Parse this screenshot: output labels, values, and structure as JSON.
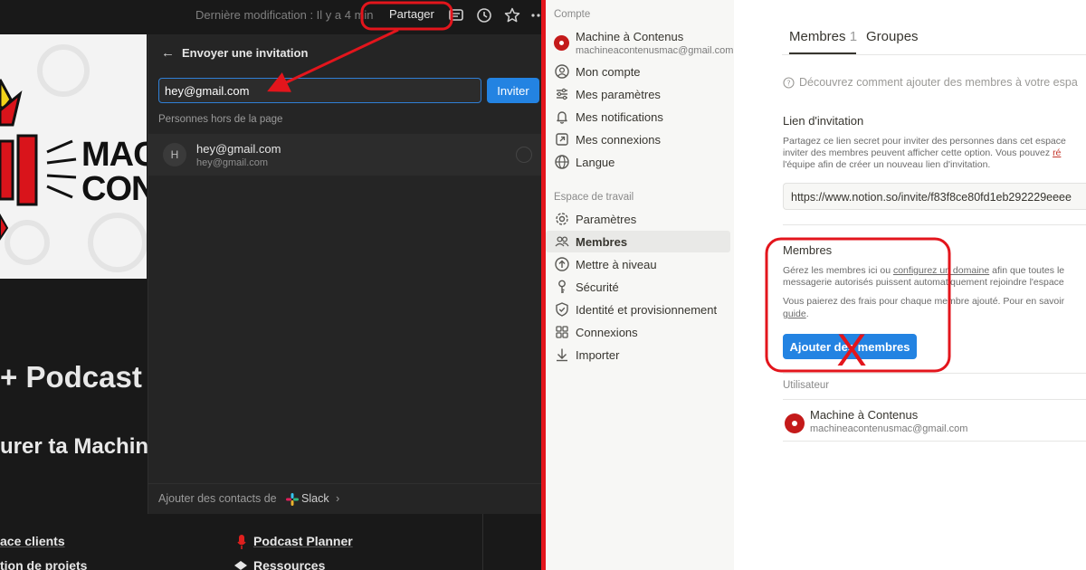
{
  "left_pane": {
    "topbar": {
      "last_modified": "Dernière modification : Il y a 4 min",
      "share_label": "Partager"
    },
    "cover": {
      "line1": "MAC",
      "line2": "CON"
    },
    "page_heading": "+ Podcast",
    "page_subheading": "urer ta Machin",
    "bottom_links": [
      "ace clients",
      "tion de projets",
      "Podcast Planner",
      "Ressources"
    ],
    "invite_popup": {
      "title": "Envoyer une invitation",
      "email_value": "hey@gmail.com",
      "invite_button": "Inviter",
      "outside_label": "Personnes hors de la page",
      "person": {
        "initial": "H",
        "name": "hey@gmail.com",
        "email": "hey@gmail.com"
      },
      "footer_text": "Ajouter des contacts de",
      "footer_app": "Slack"
    }
  },
  "settings": {
    "sidebar": {
      "account_section": "Compte",
      "account_name": "Machine à Contenus",
      "account_email": "machineacontenusmac@gmail.com",
      "account_items": [
        {
          "label": "Mon compte",
          "icon": "user-circle-icon"
        },
        {
          "label": "Mes paramètres",
          "icon": "sliders-icon"
        },
        {
          "label": "Mes notifications",
          "icon": "bell-icon"
        },
        {
          "label": "Mes connexions",
          "icon": "external-link-icon"
        },
        {
          "label": "Langue",
          "icon": "globe-icon"
        }
      ],
      "workspace_section": "Espace de travail",
      "workspace_items": [
        {
          "label": "Paramètres",
          "icon": "gear-icon"
        },
        {
          "label": "Membres",
          "icon": "people-icon",
          "active": true
        },
        {
          "label": "Mettre à niveau",
          "icon": "arrow-up-circle-icon"
        },
        {
          "label": "Sécurité",
          "icon": "key-icon"
        },
        {
          "label": "Identité et provisionnement",
          "icon": "shield-check-icon"
        },
        {
          "label": "Connexions",
          "icon": "grid-icon"
        },
        {
          "label": "Importer",
          "icon": "download-icon"
        }
      ]
    },
    "main": {
      "tabs": [
        {
          "label": "Membres",
          "count": "1"
        },
        {
          "label": "Groupes"
        }
      ],
      "learn_text": "Découvrez comment ajouter des membres à votre espa",
      "invite_link": {
        "title": "Lien d'invitation",
        "desc_line1": "Partagez ce lien secret pour inviter des personnes dans cet espace",
        "desc_line2_a": "inviter des membres peuvent afficher cette option. Vous pouvez ",
        "desc_line2_link": "ré",
        "desc_line3": "l'équipe afin de créer un nouveau lien d'invitation.",
        "url": "https://www.notion.so/invite/f83f8ce80fd1eb292229eeee"
      },
      "members": {
        "title": "Membres",
        "desc1_a": "Gérez les membres ici ou ",
        "desc1_link": "configurez un domaine",
        "desc1_b": " afin que toutes le",
        "desc2": "messagerie autorisés puissent automatiquement rejoindre l'espace",
        "desc3": "Vous paierez des frais pour chaque membre ajouté. Pour en savoir",
        "desc4_link": "guide",
        "desc4_b": ".",
        "add_button": "Ajouter des membres"
      },
      "users": {
        "header": "Utilisateur",
        "rows": [
          {
            "name": "Machine à Contenus",
            "email": "machineacontenusmac@gmail.com"
          }
        ]
      }
    }
  },
  "annotations": {
    "cross_mark": "X",
    "color": "#e3151c"
  }
}
